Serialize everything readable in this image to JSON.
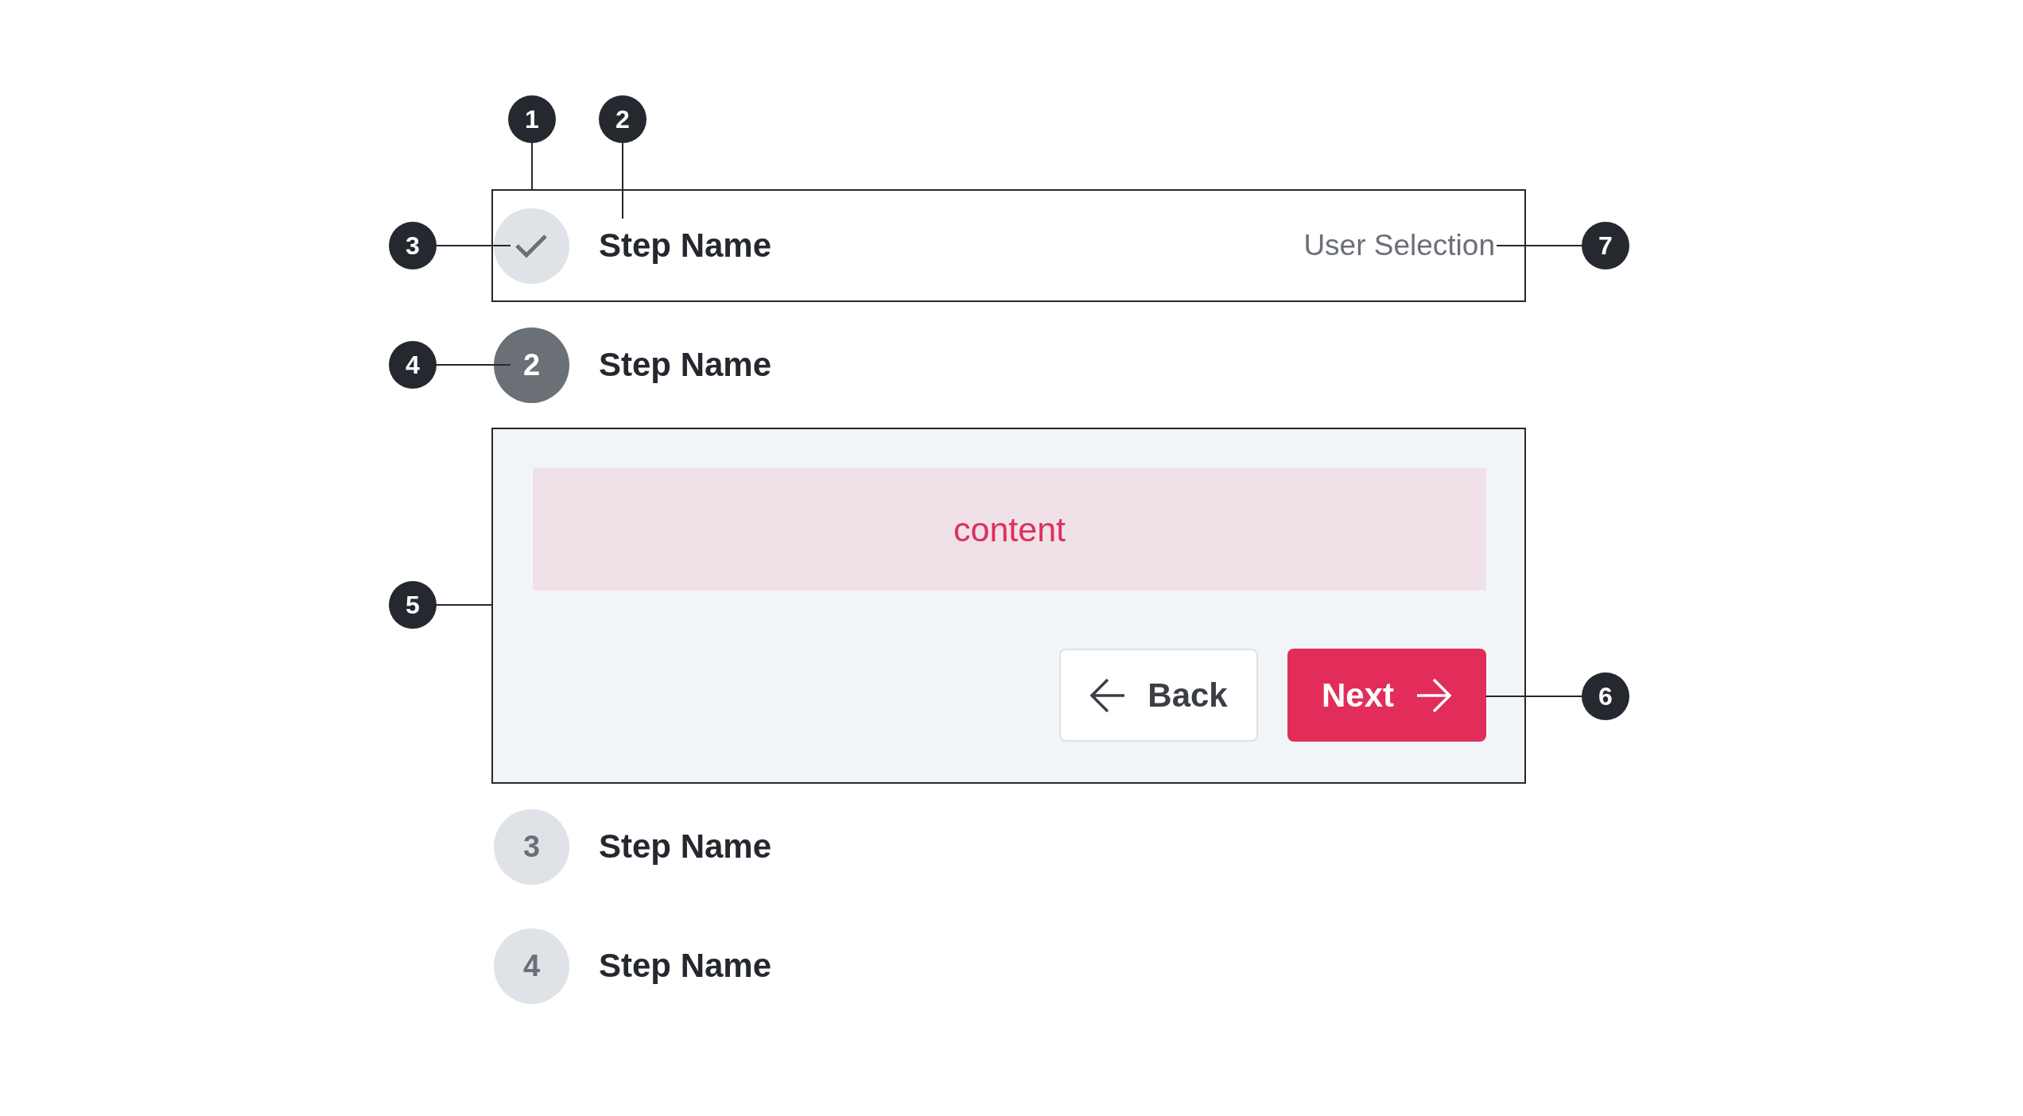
{
  "stepper": {
    "steps": [
      {
        "name": "Step Name",
        "completed": true,
        "selected": false,
        "outlined": true,
        "summary": "User Selection"
      },
      {
        "number": "2",
        "name": "Step Name",
        "completed": false,
        "selected": true,
        "outlined": false,
        "panel": {
          "content": "content",
          "buttons": [
            {
              "label": "Back",
              "kind": "secondary"
            },
            {
              "label": "Next",
              "kind": "primary"
            }
          ]
        }
      },
      {
        "number": "3",
        "name": "Step Name",
        "completed": false,
        "selected": false,
        "outlined": false
      },
      {
        "number": "4",
        "name": "Step Name",
        "completed": false,
        "selected": false,
        "outlined": false
      }
    ]
  },
  "annotations": [
    {
      "label": "1"
    },
    {
      "label": "2"
    },
    {
      "label": "3"
    },
    {
      "label": "4"
    },
    {
      "label": "5"
    },
    {
      "label": "6"
    },
    {
      "label": "7"
    }
  ]
}
